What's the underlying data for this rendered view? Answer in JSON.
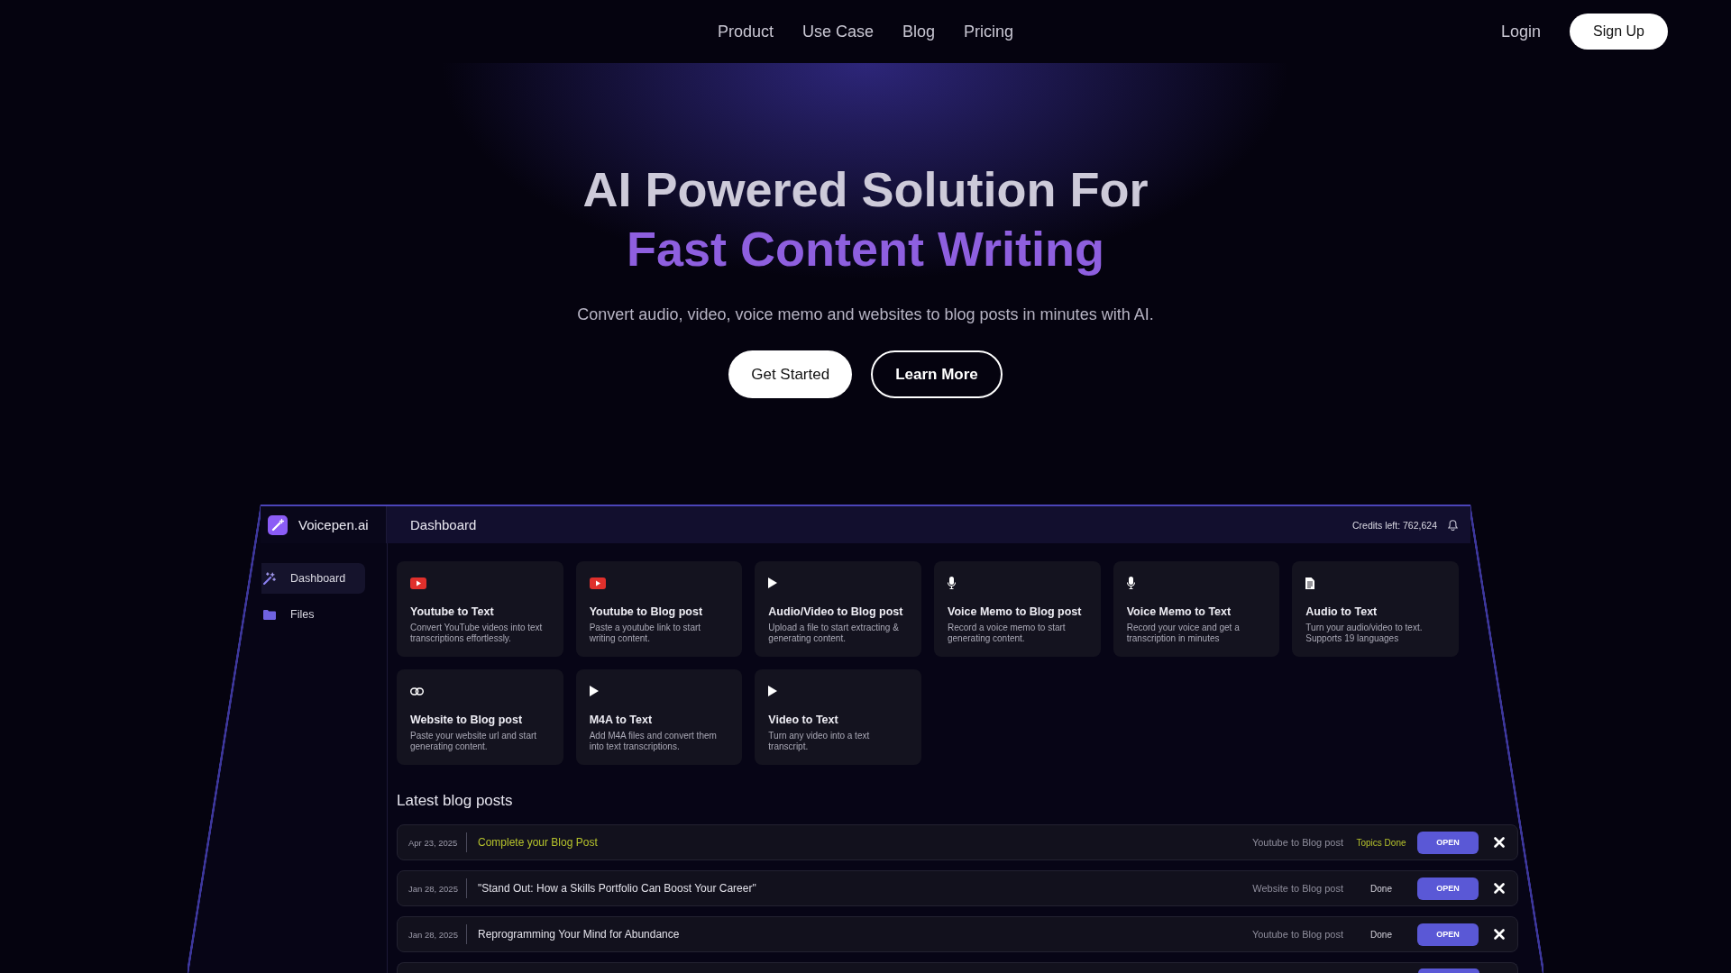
{
  "nav": {
    "links": [
      "Product",
      "Use Case",
      "Blog",
      "Pricing"
    ],
    "login": "Login",
    "signup": "Sign Up"
  },
  "hero": {
    "title_line1": "AI Powered Solution For",
    "title_line2": "Fast Content Writing",
    "subtitle": "Convert audio, video, voice memo and websites to blog posts in minutes with AI.",
    "buttons": [
      {
        "label": "Get Started",
        "kind": "filled"
      },
      {
        "label": "Learn More",
        "kind": "outline"
      }
    ]
  },
  "dashboard": {
    "brand": "Voicepen.ai",
    "title": "Dashboard",
    "credits": "Credits left: 762,624",
    "sidebar": [
      {
        "label": "Dashboard",
        "kind": "dashboard",
        "selected": true
      },
      {
        "label": "Files",
        "kind": "files",
        "selected": false
      }
    ],
    "tools": [
      {
        "kind": "youtube",
        "title": "Youtube to Text",
        "description": "Convert YouTube videos into text transcriptions effortlessly."
      },
      {
        "kind": "youtube",
        "title": "Youtube to Blog post",
        "description": "Paste a youtube link to start writing content."
      },
      {
        "kind": "media",
        "title": "Audio/Video to Blog post",
        "description": "Upload a file to start extracting & generating content."
      },
      {
        "kind": "voice",
        "title": "Voice Memo to Blog post",
        "description": "Record a voice memo to start generating content."
      },
      {
        "kind": "voice",
        "title": "Voice Memo to Text",
        "description": "Record your voice and get a transcription in minutes"
      },
      {
        "kind": "file",
        "title": "Audio to Text",
        "description": "Turn your audio/video to text. Supports 19 languages"
      },
      {
        "kind": "website",
        "title": "Website to Blog post",
        "description": "Paste your website url and start generating content."
      },
      {
        "kind": "media",
        "title": "M4A to Text",
        "description": "Add M4A files and convert them into text transcriptions."
      },
      {
        "kind": "media",
        "title": "Video to Text",
        "description": "Turn any video into a text transcript."
      }
    ],
    "latest_heading": "Latest blog posts",
    "posts": [
      {
        "kind": "post",
        "date": "Apr 23, 2025",
        "title": "Complete your Blog Post",
        "type": "Youtube to Blog post",
        "status": "Topics Done",
        "in_progress": true,
        "action": "OPEN"
      },
      {
        "kind": "post",
        "date": "Jan 28, 2025",
        "title": "\"Stand Out: How a Skills Portfolio Can Boost Your Career\"",
        "type": "Website to Blog post",
        "status": "Done",
        "in_progress": false,
        "action": "OPEN"
      },
      {
        "kind": "post",
        "date": "Jan 28, 2025",
        "title": "Reprogramming Your Mind for Abundance",
        "type": "Youtube to Blog post",
        "status": "Done",
        "in_progress": false,
        "action": "OPEN"
      },
      {
        "kind": "cut_off"
      }
    ]
  }
}
